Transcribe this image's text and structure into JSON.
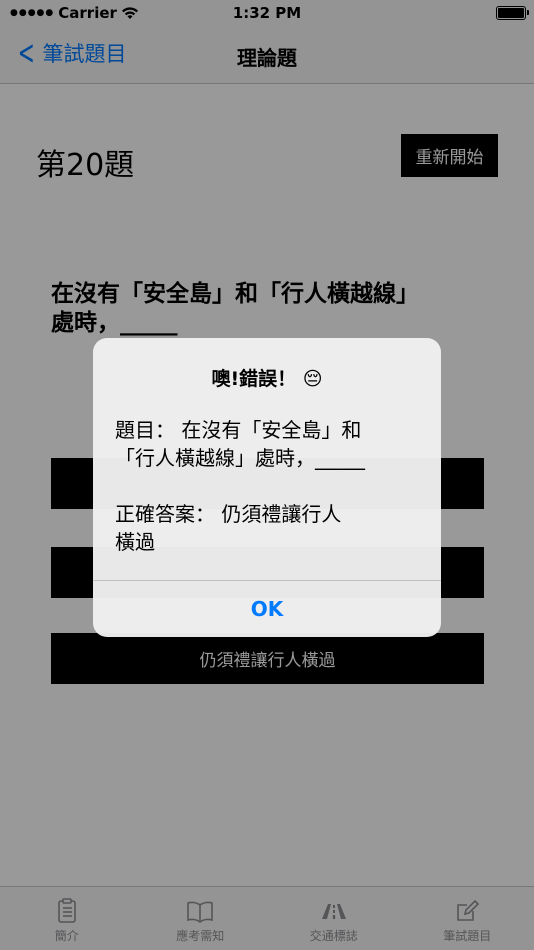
{
  "status_bar": {
    "carrier": "Carrier",
    "time": "1:32 PM"
  },
  "nav": {
    "back_label": "筆試題目",
    "title": "理論題"
  },
  "quiz": {
    "number_label": "第20題",
    "restart_label": "重新開始",
    "question_line1": "在沒有「安全島」和「行人橫越線」",
    "question_line2": "處時，_____",
    "answers": [
      "",
      "",
      "仍須禮讓行人橫過"
    ]
  },
  "alert": {
    "title": "噢!錯誤！ 😔",
    "question_line1": "題目：  在沒有「安全島」和",
    "question_line2": "「行人橫越線」處時，_____",
    "answer_line1": "正確答案：  仍須禮讓行人",
    "answer_line2": "橫過",
    "ok_label": "OK"
  },
  "tabs": [
    {
      "label": "簡介",
      "icon": "clipboard-icon"
    },
    {
      "label": "應考需知",
      "icon": "book-icon"
    },
    {
      "label": "交通標誌",
      "icon": "road-icon"
    },
    {
      "label": "筆試題目",
      "icon": "pencil-square-icon"
    }
  ],
  "colors": {
    "accent": "#007aff",
    "button_bg": "#000000",
    "tab_inactive": "#8e8e93"
  }
}
